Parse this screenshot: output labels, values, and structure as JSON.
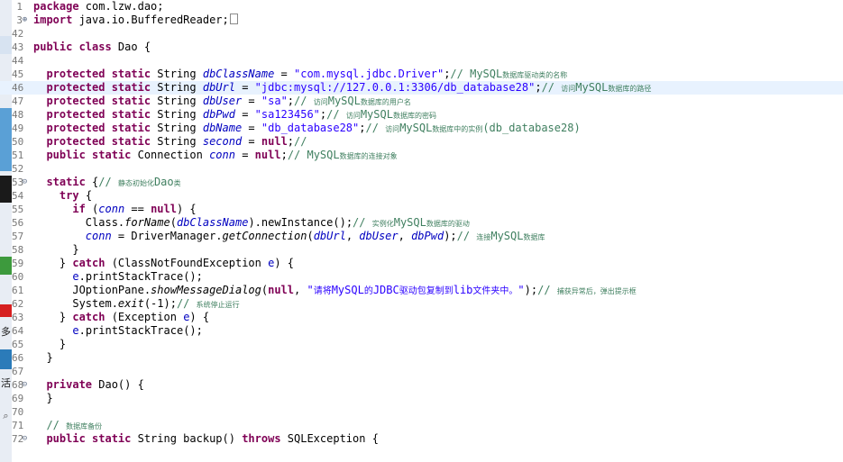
{
  "editor": {
    "lines": [
      {
        "n": "1",
        "code": [
          [
            "kw",
            "package"
          ],
          [
            "",
            "  com.lzw.dao;"
          ]
        ]
      },
      {
        "n": "3",
        "fold": "+",
        "code": [
          [
            "kw",
            "import"
          ],
          [
            "",
            "  java.io.BufferedReader;"
          ],
          [
            "box",
            ""
          ]
        ]
      },
      {
        "n": "42",
        "code": []
      },
      {
        "n": "43",
        "code": [
          [
            "kw",
            "public class"
          ],
          [
            "",
            "  Dao {"
          ]
        ]
      },
      {
        "n": "44",
        "code": []
      },
      {
        "n": "45",
        "code": [
          [
            "",
            "    "
          ],
          [
            "kw",
            "protected static"
          ],
          [
            "",
            "  String "
          ],
          [
            "fld",
            "dbClassName"
          ],
          [
            "",
            " = "
          ],
          [
            "str",
            "\"com.mysql.jdbc.Driver\""
          ],
          [
            "",
            ";"
          ],
          [
            "cmt",
            "// MySQL"
          ],
          [
            "cmtcn",
            "数据库驱动类的名称"
          ]
        ]
      },
      {
        "n": "46",
        "cur": true,
        "code": [
          [
            "",
            "    "
          ],
          [
            "kw",
            "protected static"
          ],
          [
            "",
            "  String "
          ],
          [
            "fld",
            "dbUrl"
          ],
          [
            "",
            " = "
          ],
          [
            "str",
            "\"jdbc:mysql://127.0.0.1:3306/db_database28\""
          ],
          [
            "",
            ";"
          ],
          [
            "cmt",
            "// "
          ],
          [
            "cmtcn",
            "访问"
          ],
          [
            "cmt",
            "MySQL"
          ],
          [
            "cmtcn",
            "数据库的路径"
          ]
        ]
      },
      {
        "n": "47",
        "code": [
          [
            "",
            "    "
          ],
          [
            "kw",
            "protected static"
          ],
          [
            "",
            "  String "
          ],
          [
            "fld",
            "dbUser"
          ],
          [
            "",
            " = "
          ],
          [
            "str",
            "\"sa\""
          ],
          [
            "",
            ";"
          ],
          [
            "cmt",
            "// "
          ],
          [
            "cmtcn",
            "访问"
          ],
          [
            "cmt",
            "MySQL"
          ],
          [
            "cmtcn",
            "数据库的用户名"
          ]
        ]
      },
      {
        "n": "48",
        "code": [
          [
            "",
            "    "
          ],
          [
            "kw",
            "protected static"
          ],
          [
            "",
            "  String "
          ],
          [
            "fld",
            "dbPwd"
          ],
          [
            "",
            " = "
          ],
          [
            "str",
            "\"sa123456\""
          ],
          [
            "",
            ";"
          ],
          [
            "cmt",
            "// "
          ],
          [
            "cmtcn",
            "访问"
          ],
          [
            "cmt",
            "MySQL"
          ],
          [
            "cmtcn",
            "数据库的密码"
          ]
        ]
      },
      {
        "n": "49",
        "code": [
          [
            "",
            "    "
          ],
          [
            "kw",
            "protected static"
          ],
          [
            "",
            "  String "
          ],
          [
            "fld",
            "dbName"
          ],
          [
            "",
            " = "
          ],
          [
            "str",
            "\"db_database28\""
          ],
          [
            "",
            ";"
          ],
          [
            "cmt",
            "// "
          ],
          [
            "cmtcn",
            "访问"
          ],
          [
            "cmt",
            "MySQL"
          ],
          [
            "cmtcn",
            "数据库中的实例"
          ],
          [
            "cmt",
            "(db_database28)"
          ]
        ]
      },
      {
        "n": "50",
        "code": [
          [
            "",
            "    "
          ],
          [
            "kw",
            "protected static"
          ],
          [
            "",
            "  String "
          ],
          [
            "fld",
            "second"
          ],
          [
            "",
            " = "
          ],
          [
            "kw",
            "null"
          ],
          [
            "",
            ";"
          ],
          [
            "cmt",
            "//"
          ]
        ]
      },
      {
        "n": "51",
        "code": [
          [
            "",
            "    "
          ],
          [
            "kw",
            "public static"
          ],
          [
            "",
            "  Connection "
          ],
          [
            "fld",
            "conn"
          ],
          [
            "",
            " = "
          ],
          [
            "kw",
            "null"
          ],
          [
            "",
            ";"
          ],
          [
            "cmt",
            "// MySQL"
          ],
          [
            "cmtcn",
            "数据库的连接对象"
          ]
        ]
      },
      {
        "n": "52",
        "code": []
      },
      {
        "n": "53",
        "fold": "-",
        "code": [
          [
            "",
            "    "
          ],
          [
            "kw",
            "static"
          ],
          [
            "",
            " {"
          ],
          [
            "cmt",
            "// "
          ],
          [
            "cmtcn",
            "静态初始化"
          ],
          [
            "cmt",
            "Dao"
          ],
          [
            "cmtcn",
            "类"
          ]
        ]
      },
      {
        "n": "54",
        "code": [
          [
            "",
            "        "
          ],
          [
            "kw",
            "try"
          ],
          [
            "",
            " {"
          ]
        ]
      },
      {
        "n": "55",
        "code": [
          [
            "",
            "            "
          ],
          [
            "kw",
            "if"
          ],
          [
            "",
            " ("
          ],
          [
            "fld",
            "conn"
          ],
          [
            "",
            " == "
          ],
          [
            "kw",
            "null"
          ],
          [
            "",
            ") {"
          ]
        ]
      },
      {
        "n": "56",
        "code": [
          [
            "",
            "                Class."
          ],
          [
            "stm",
            "forName"
          ],
          [
            "",
            "("
          ],
          [
            "fld",
            "dbClassName"
          ],
          [
            "",
            ").newInstance();"
          ],
          [
            "cmt",
            "// "
          ],
          [
            "cmtcn",
            "实例化"
          ],
          [
            "cmt",
            "MySQL"
          ],
          [
            "cmtcn",
            "数据库的驱动"
          ]
        ]
      },
      {
        "n": "57",
        "code": [
          [
            "",
            "                "
          ],
          [
            "fld",
            "conn"
          ],
          [
            "",
            " = DriverManager."
          ],
          [
            "stm",
            "getConnection"
          ],
          [
            "",
            "("
          ],
          [
            "fld",
            "dbUrl"
          ],
          [
            "",
            ", "
          ],
          [
            "fld",
            "dbUser"
          ],
          [
            "",
            ", "
          ],
          [
            "fld",
            "dbPwd"
          ],
          [
            "",
            ");"
          ],
          [
            "cmt",
            "// "
          ],
          [
            "cmtcn",
            "连接"
          ],
          [
            "cmt",
            "MySQL"
          ],
          [
            "cmtcn",
            "数据库"
          ]
        ]
      },
      {
        "n": "58",
        "code": [
          [
            "",
            "            }"
          ]
        ]
      },
      {
        "n": "59",
        "code": [
          [
            "",
            "        } "
          ],
          [
            "kw",
            "catch"
          ],
          [
            "",
            " (ClassNotFoundException "
          ],
          [
            "var",
            "e"
          ],
          [
            "",
            ") {"
          ]
        ]
      },
      {
        "n": "60",
        "code": [
          [
            "",
            "            "
          ],
          [
            "var",
            "e"
          ],
          [
            "",
            ".printStackTrace();"
          ]
        ]
      },
      {
        "n": "61",
        "code": [
          [
            "",
            "            JOptionPane."
          ],
          [
            "stm",
            "showMessageDialog"
          ],
          [
            "",
            "("
          ],
          [
            "kw",
            "null"
          ],
          [
            "",
            ", "
          ],
          [
            "str",
            "\""
          ],
          [
            "strcn",
            "请将"
          ],
          [
            "str",
            "MySQL"
          ],
          [
            "strcn",
            "的"
          ],
          [
            "str",
            "JDBC"
          ],
          [
            "strcn",
            "驱动包复制到"
          ],
          [
            "str",
            "lib"
          ],
          [
            "strcn",
            "文件夹中。"
          ],
          [
            "str",
            "\""
          ],
          [
            "",
            ");"
          ],
          [
            "cmt",
            "// "
          ],
          [
            "cmtcn",
            "捕获异常后，弹出提示框"
          ]
        ]
      },
      {
        "n": "62",
        "code": [
          [
            "",
            "            System."
          ],
          [
            "stm",
            "exit"
          ],
          [
            "",
            "(-1);"
          ],
          [
            "cmt",
            "// "
          ],
          [
            "cmtcn",
            "系统停止运行"
          ]
        ]
      },
      {
        "n": "63",
        "code": [
          [
            "",
            "        } "
          ],
          [
            "kw",
            "catch"
          ],
          [
            "",
            " (Exception "
          ],
          [
            "var",
            "e"
          ],
          [
            "",
            ") {"
          ]
        ]
      },
      {
        "n": "64",
        "code": [
          [
            "",
            "            "
          ],
          [
            "var",
            "e"
          ],
          [
            "",
            ".printStackTrace();"
          ]
        ]
      },
      {
        "n": "65",
        "code": [
          [
            "",
            "        }"
          ]
        ]
      },
      {
        "n": "66",
        "code": [
          [
            "",
            "    }"
          ]
        ]
      },
      {
        "n": "67",
        "code": []
      },
      {
        "n": "68",
        "fold": "-",
        "code": [
          [
            "",
            "    "
          ],
          [
            "kw",
            "private"
          ],
          [
            "",
            "  Dao() {"
          ]
        ]
      },
      {
        "n": "69",
        "code": [
          [
            "",
            "    }"
          ]
        ]
      },
      {
        "n": "70",
        "code": []
      },
      {
        "n": "71",
        "code": [
          [
            "",
            "    "
          ],
          [
            "cmt",
            "// "
          ],
          [
            "cmtcn",
            "数据库备份"
          ]
        ]
      },
      {
        "n": "72",
        "fold": "-",
        "code": [
          [
            "",
            "    "
          ],
          [
            "kw",
            "public static"
          ],
          [
            "",
            "  String backup() "
          ],
          [
            "kw",
            "throws"
          ],
          [
            "",
            "  SQLException {"
          ]
        ]
      }
    ]
  },
  "side_panel_chars": [
    "多",
    "活"
  ],
  "colors": {
    "keyword": "#7f0055",
    "string": "#2a00ff",
    "field": "#0000c0",
    "comment": "#3f7f5f",
    "current_line": "#e8f2fe"
  }
}
